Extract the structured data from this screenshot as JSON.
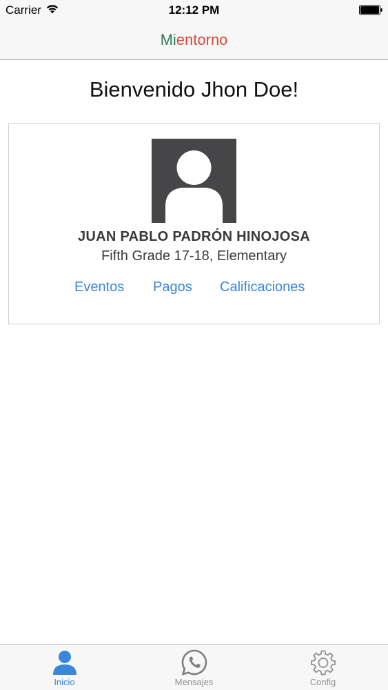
{
  "status_bar": {
    "carrier": "Carrier",
    "time": "12:12 PM",
    "icons": [
      "wifi-icon",
      "battery-icon"
    ]
  },
  "nav_bar": {
    "title_part1": "Mi",
    "title_part2": "entorno",
    "colors": {
      "part1": "#2e7d5b",
      "part2": "#d9493b"
    }
  },
  "welcome": {
    "text": "Bienvenido Jhon Doe!"
  },
  "student_card": {
    "avatar_icon": "user-silhouette-icon",
    "name": "JUAN PABLO PADRÓN HINOJOSA",
    "grade": "Fifth Grade 17-18, Elementary",
    "links": {
      "eventos": "Eventos",
      "pagos": "Pagos",
      "calificaciones": "Calificaciones"
    },
    "link_color": "#3a86d8"
  },
  "tab_bar": {
    "active_color": "#3a86d8",
    "inactive_color": "#8e8e93",
    "tabs": [
      {
        "label": "Inicio",
        "icon": "person-icon",
        "active": true
      },
      {
        "label": "Mensajes",
        "icon": "whatsapp-chat-icon",
        "active": false
      },
      {
        "label": "Config",
        "icon": "gear-icon",
        "active": false
      }
    ]
  }
}
